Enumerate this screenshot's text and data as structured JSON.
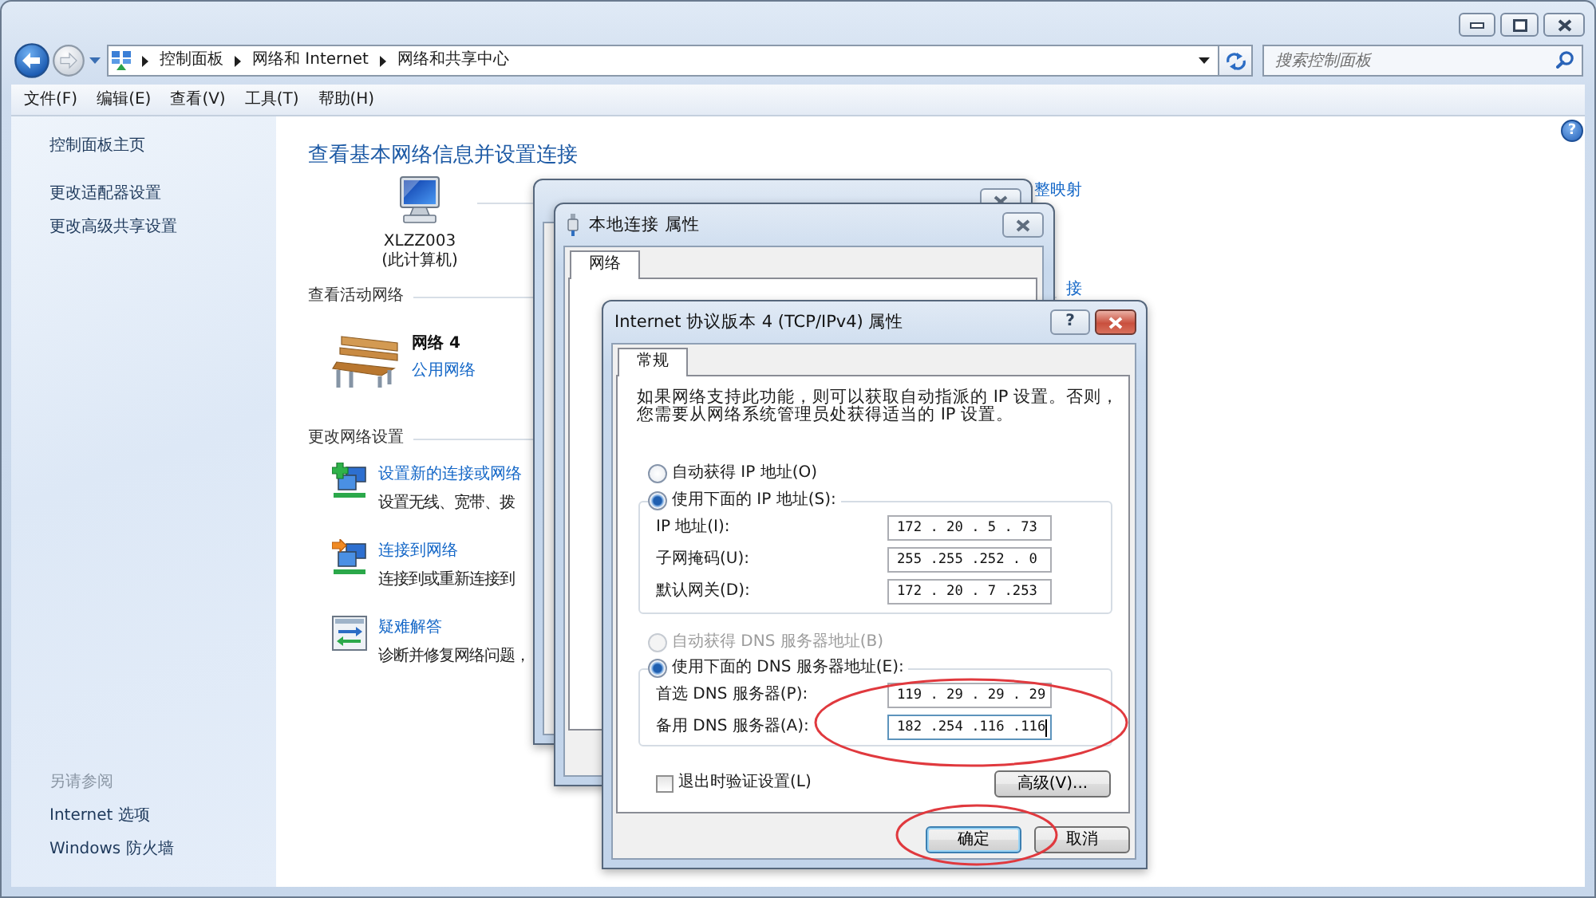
{
  "window": {
    "help": "?"
  },
  "address_bar": {
    "crumbs": [
      {
        "label": "控制面板"
      },
      {
        "label": "网络和 Internet"
      },
      {
        "label": "网络和共享中心"
      }
    ]
  },
  "search": {
    "placeholder": "搜索控制面板"
  },
  "menu": [
    {
      "label": "文件(F)"
    },
    {
      "label": "编辑(E)"
    },
    {
      "label": "查看(V)"
    },
    {
      "label": "工具(T)"
    },
    {
      "label": "帮助(H)"
    }
  ],
  "sidebar": {
    "items": [
      {
        "label": "控制面板主页"
      },
      {
        "label": "更改适配器设置"
      },
      {
        "label": "更改高级共享设置"
      }
    ],
    "see_also": {
      "heading": "另请参阅",
      "items": [
        {
          "label": "Internet 选项"
        },
        {
          "label": "Windows 防火墙"
        }
      ]
    }
  },
  "main": {
    "title": "查看基本网络信息并设置连接",
    "computer": {
      "name": "XLZZ003",
      "caption": "(此计算机)"
    },
    "map_link": "整映射",
    "active": {
      "heading": "查看活动网络",
      "link": "接",
      "network": {
        "name": "网络 4",
        "category": "公用网络"
      }
    },
    "change": {
      "heading": "更改网络设置",
      "tasks": [
        {
          "kind": "new",
          "title": "设置新的连接或网络",
          "description": "设置无线、宽带、拨"
        },
        {
          "kind": "connect",
          "title": "连接到网络",
          "description": "连接到或重新连接到"
        },
        {
          "kind": "troubleshoot",
          "title": "疑难解答",
          "description": "诊断并修复网络问题，"
        }
      ]
    }
  },
  "background_windows": [
    {
      "kind": "status"
    },
    {
      "kind": "properties",
      "title": "本地连接 属性",
      "tabs": [
        {
          "label": "网络",
          "selected": true
        }
      ]
    }
  ],
  "ipv4_dialog": {
    "title": "Internet 协议版本 4 (TCP/IPv4) 属性",
    "help": "?",
    "tabs": [
      {
        "label": "常规",
        "selected": true
      }
    ],
    "intro": "如果网络支持此功能，则可以获取自动指派的 IP 设置。否则，您需要从网络系统管理员处获得适当的 IP 设置。",
    "ip": {
      "modes": [
        {
          "label": "自动获得 IP 地址(O)",
          "selected": false,
          "disabled": false
        },
        {
          "label": "使用下面的 IP 地址(S):",
          "selected": true,
          "disabled": false
        }
      ],
      "fields": [
        {
          "label": "IP 地址(I):",
          "value": "172 . 20 . 5 . 73",
          "focused": false
        },
        {
          "label": "子网掩码(U):",
          "value": "255 .255 .252 . 0",
          "focused": false
        },
        {
          "label": "默认网关(D):",
          "value": "172 . 20 . 7 .253",
          "focused": false
        }
      ],
      "circled": false
    },
    "dns": {
      "modes": [
        {
          "label": "自动获得 DNS 服务器地址(B)",
          "selected": false,
          "disabled": true
        },
        {
          "label": "使用下面的 DNS 服务器地址(E):",
          "selected": true,
          "disabled": false
        }
      ],
      "fields": [
        {
          "label": "首选 DNS 服务器(P):",
          "value": "119 . 29 . 29 . 29",
          "focused": false
        },
        {
          "label": "备用 DNS 服务器(A):",
          "value": "182 .254 .116 .116",
          "focused": true
        }
      ],
      "circled": true
    },
    "validate": {
      "label": "退出时验证设置(L)",
      "checked": false
    },
    "advanced": "高级(V)...",
    "buttons": [
      {
        "label": "确定",
        "default": true,
        "circled": true
      },
      {
        "label": "取消",
        "default": false,
        "circled": false
      }
    ]
  }
}
